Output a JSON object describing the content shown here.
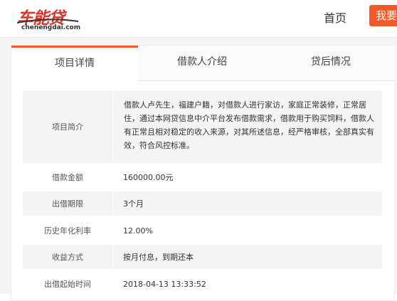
{
  "header": {
    "logo_text": "车能贷",
    "logo_domain": "chenengdai.com",
    "nav_home": "首页",
    "nav_cta": "我要",
    "accent_color": "#f05a28",
    "logo_color": "#e4322b"
  },
  "tabs": [
    {
      "label": "项目详情",
      "active": true
    },
    {
      "label": "借款人介绍",
      "active": false
    },
    {
      "label": "贷后情况",
      "active": false
    }
  ],
  "details": {
    "intro_label": "项目简介",
    "intro_text": "借款人卢先生，福建户籍，对借款人进行家访，家庭正常装修，正常居住，通过本网贷信息中介平台发布借款需求，借款用于购买饲料，借款人有正常且相对稳定的收入来源，对其所述信息，经严格审核，全部真实有效，符合风控标准。",
    "rows": [
      {
        "label": "借款金额",
        "value": "160000.00元"
      },
      {
        "label": "出借期限",
        "value": "3个月"
      },
      {
        "label": "历史年化利率",
        "value": "12.00%"
      },
      {
        "label": "收益方式",
        "value": "按月付息，到期还本"
      },
      {
        "label": "出借起始时间",
        "value": "2018-04-13 13:33:52"
      }
    ]
  }
}
